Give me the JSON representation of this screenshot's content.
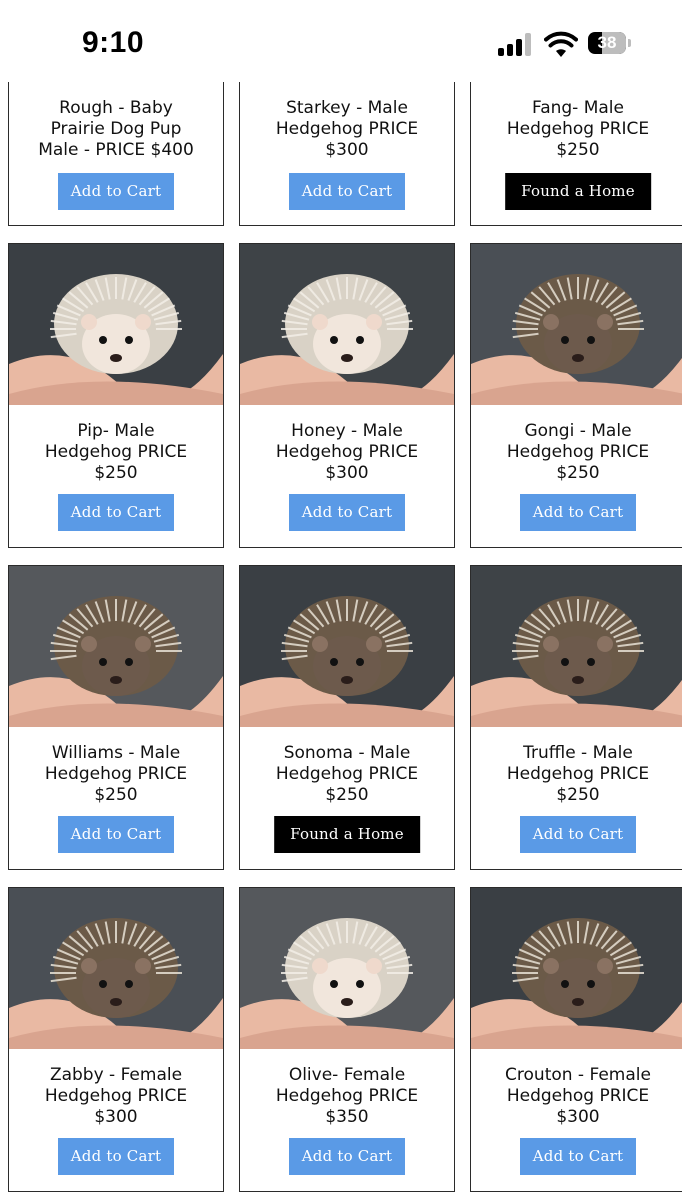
{
  "status_bar": {
    "time": "9:10",
    "battery": "38",
    "battery_level": 0.38
  },
  "products": [
    {
      "name": "Rough - Baby\nPrairie Dog Pup\nMale - PRICE $400",
      "button": "Add to Cart",
      "available": true
    },
    {
      "name": "Starkey - Male\nHedgehog PRICE\n$300",
      "button": "Add to Cart",
      "available": true
    },
    {
      "name": "Fang- Male\nHedgehog PRICE\n$250",
      "button": "Found a Home",
      "available": false
    },
    {
      "name": "Pip- Male\nHedgehog PRICE\n$250",
      "button": "Add to Cart",
      "available": true
    },
    {
      "name": "Honey - Male\nHedgehog PRICE\n$300",
      "button": "Add to Cart",
      "available": true
    },
    {
      "name": "Gongi - Male\nHedgehog PRICE\n$250",
      "button": "Add to Cart",
      "available": true
    },
    {
      "name": "Williams - Male\nHedgehog PRICE\n$250",
      "button": "Add to Cart",
      "available": true
    },
    {
      "name": "Sonoma - Male\nHedgehog PRICE\n$250",
      "button": "Found a Home",
      "available": false
    },
    {
      "name": "Truffle - Male\nHedgehog PRICE\n$250",
      "button": "Add to Cart",
      "available": true
    },
    {
      "name": "Zabby - Female\nHedgehog PRICE\n$300",
      "button": "Add to Cart",
      "available": true
    },
    {
      "name": "Olive- Female\nHedgehog PRICE\n$350",
      "button": "Add to Cart",
      "available": true
    },
    {
      "name": "Crouton - Female\nHedgehog PRICE\n$300",
      "button": "Add to Cart",
      "available": true
    }
  ],
  "colors": {
    "add_to_cart": "#5a9ae6",
    "found_a_home": "#000000",
    "card_border": "#2b2b2b"
  }
}
